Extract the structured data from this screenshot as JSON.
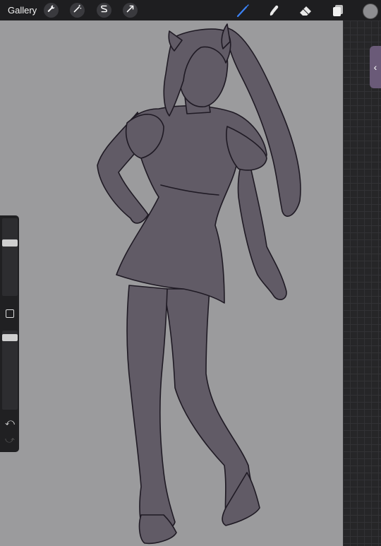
{
  "toolbar": {
    "gallery_label": "Gallery",
    "left_tools": [
      "wrench-icon",
      "magic-wand-icon",
      "selection-icon",
      "transform-arrow-icon"
    ],
    "right_tools": [
      "brush-icon",
      "smudge-icon",
      "eraser-icon",
      "layers-icon"
    ],
    "active_tool": "brush-icon",
    "active_color": "#8d8d90",
    "accent": "#3b82f6"
  },
  "sidebar": {
    "undo_glyph": "⤺",
    "redo_glyph": "⤻",
    "brush_size": 0.7,
    "brush_opacity": 0.95
  },
  "layers_tab": {
    "glyph": "‹"
  },
  "canvas": {
    "background": "#9b9b9d",
    "fill_color": "#615b66",
    "line_color": "#1f1a24"
  }
}
